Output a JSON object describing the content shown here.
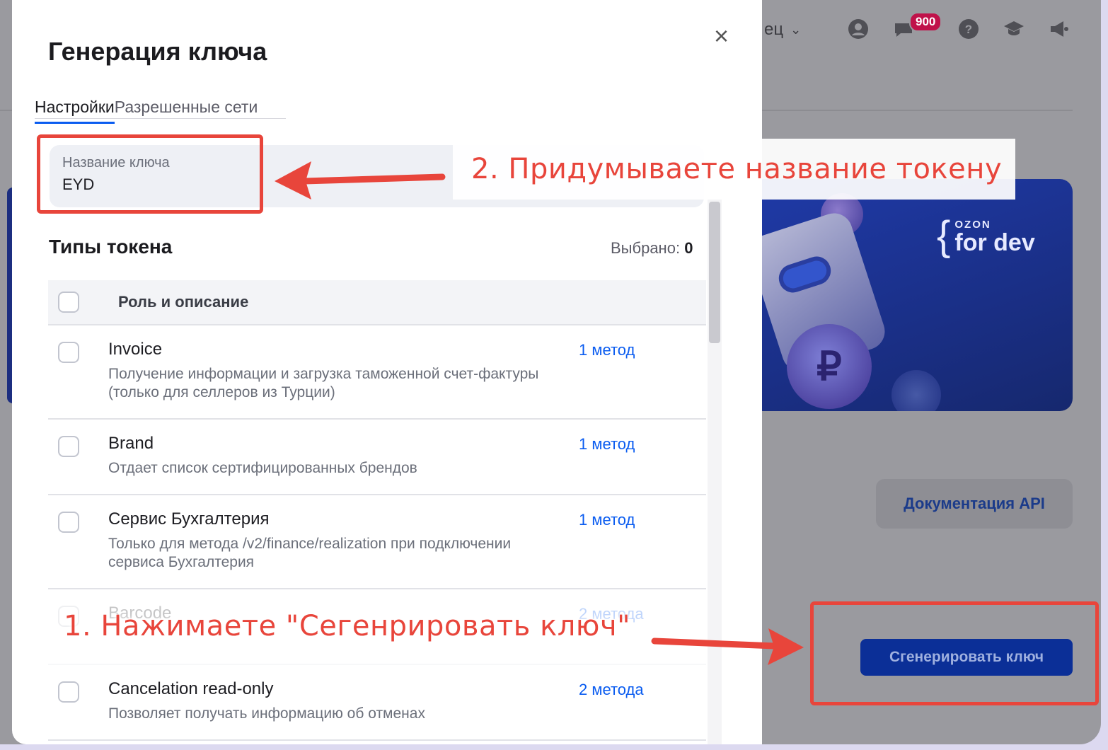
{
  "background": {
    "user_menu": "ец",
    "notifications_badge": "900",
    "banner_logo_small": "OZON",
    "banner_logo_big": "for dev",
    "banner_coin_symbol": "₽",
    "docs_button": "Документация API",
    "generate_button": "Сгенерировать ключ"
  },
  "modal": {
    "title": "Генерация ключа",
    "close_symbol": "×",
    "tabs": [
      {
        "label": "Настройки",
        "active": true
      },
      {
        "label": "Разрешенные сети",
        "active": false
      }
    ],
    "key_field": {
      "label": "Название ключа",
      "value": "EYD"
    },
    "types_title": "Типы токена",
    "selected_label": "Выбрано:",
    "selected_count": "0",
    "table_header": "Роль и описание",
    "rows": [
      {
        "name": "Invoice",
        "description": "Получение информации и загрузка таможенной счет-фактуры (только для селлеров из Турции)",
        "methods": "1 метод"
      },
      {
        "name": "Brand",
        "description": "Отдает список сертифицированных брендов",
        "methods": "1 метод"
      },
      {
        "name": "Сервис Бухгалтерия",
        "description": "Только для метода /v2/finance/realization при подключении сервиса Бухгалтерия",
        "methods": "1 метод"
      },
      {
        "name": "Barcode",
        "description": "",
        "methods": "2 метода"
      },
      {
        "name": "Cancelation read-only",
        "description": "Позволяет получать информацию об отменах",
        "methods": "2 метода"
      }
    ]
  },
  "annotations": {
    "step1": "1. Нажимаете \"Сегенрировать ключ\"",
    "step2": "2. Придумываете название токену",
    "color": "#e8453b"
  },
  "colors": {
    "accent": "#0a5cf0",
    "primary_button": "#0b2f97",
    "badge": "#c0124a"
  }
}
